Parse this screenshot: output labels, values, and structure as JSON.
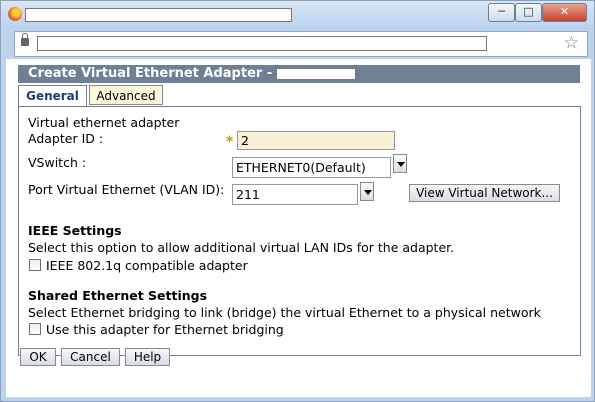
{
  "window": {
    "title_text": "",
    "url_text": "",
    "controls": {
      "minimize": "─",
      "maximize": "□",
      "close": "✕"
    }
  },
  "dialog": {
    "title": "Create Virtual Ethernet Adapter -",
    "tabs": [
      "General",
      "Advanced"
    ],
    "section_label": "Virtual ethernet adapter",
    "adapter_id": {
      "label": "Adapter ID :",
      "required_mark": "*",
      "value": "2"
    },
    "vswitch": {
      "label": "VSwitch :",
      "value": "ETHERNET0(Default)"
    },
    "port_vlan": {
      "label": "Port Virtual Ethernet (VLAN ID):",
      "value": "211"
    },
    "view_network_button": "View Virtual Network...",
    "ieee": {
      "heading": "IEEE Settings",
      "description": "Select this option to allow additional virtual LAN IDs for the adapter.",
      "checkbox_label": "IEEE 802.1q compatible adapter",
      "checked": false
    },
    "shared": {
      "heading": "Shared Ethernet Settings",
      "description": "Select Ethernet bridging to link (bridge) the virtual Ethernet to a physical network",
      "checkbox_label": "Use this adapter for Ethernet bridging",
      "checked": false
    },
    "buttons": {
      "ok": "OK",
      "cancel": "Cancel",
      "help": "Help"
    }
  },
  "colors": {
    "titlebar": "#6e7f96",
    "required_field": "#f9f0d8",
    "active_tab_text": "#1d3d7a"
  }
}
